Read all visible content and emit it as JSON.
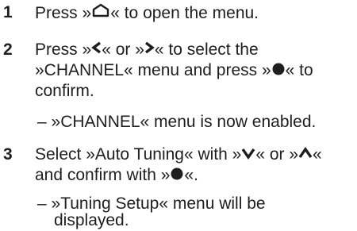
{
  "steps": [
    {
      "number": "1",
      "line1_pre": "Press »",
      "line1_post": "« to open the menu.",
      "icon": "home-icon"
    },
    {
      "number": "2",
      "line1_a": "Press »",
      "line1_b": "« or »",
      "line1_c": "« to select the",
      "line2_a": "»CHANNEL« menu and press »",
      "line2_b": "« to",
      "line3": "confirm.",
      "icons": [
        "chevron-left-icon",
        "chevron-right-icon",
        "filled-circle-icon"
      ],
      "result": "– »CHANNEL« menu is now enabled."
    },
    {
      "number": "3",
      "line1_a": "Select »Auto Tuning« with »",
      "line1_b": "« or »",
      "line1_c": "«",
      "line2_a": "and confirm  with »",
      "line2_b": "«.",
      "icons": [
        "chevron-down-icon",
        "chevron-up-icon",
        "filled-circle-icon"
      ],
      "result_line1": "– »Tuning Setup« menu will be",
      "result_line2": "displayed."
    }
  ]
}
